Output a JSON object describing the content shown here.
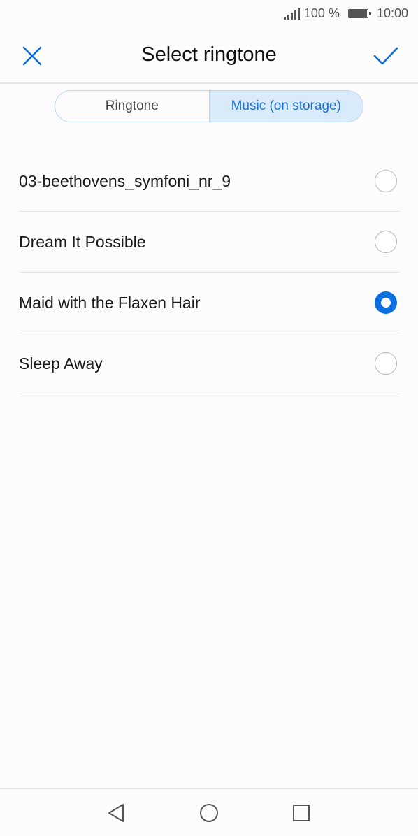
{
  "status_bar": {
    "battery_text": "100 %",
    "time": "10:00",
    "battery_level": 1.0,
    "signal_bars": 5
  },
  "header": {
    "title": "Select ringtone",
    "close_icon": "close-icon",
    "confirm_icon": "checkmark-icon"
  },
  "tabs": [
    {
      "label": "Ringtone",
      "active": false
    },
    {
      "label": "Music (on storage)",
      "active": true
    }
  ],
  "list": {
    "items": [
      {
        "label": "03-beethovens_symfoni_nr_9",
        "selected": false
      },
      {
        "label": "Dream It Possible",
        "selected": false
      },
      {
        "label": "Maid with the Flaxen Hair",
        "selected": true
      },
      {
        "label": "Sleep Away",
        "selected": false
      }
    ]
  },
  "nav_bar": {
    "back_icon": "back-triangle-icon",
    "home_icon": "home-circle-icon",
    "recent_icon": "recent-apps-square-icon"
  },
  "colors": {
    "accent": "#0a6fe0",
    "tab_active_bg": "#d9ebfb",
    "tab_border": "#bcd8f2"
  }
}
